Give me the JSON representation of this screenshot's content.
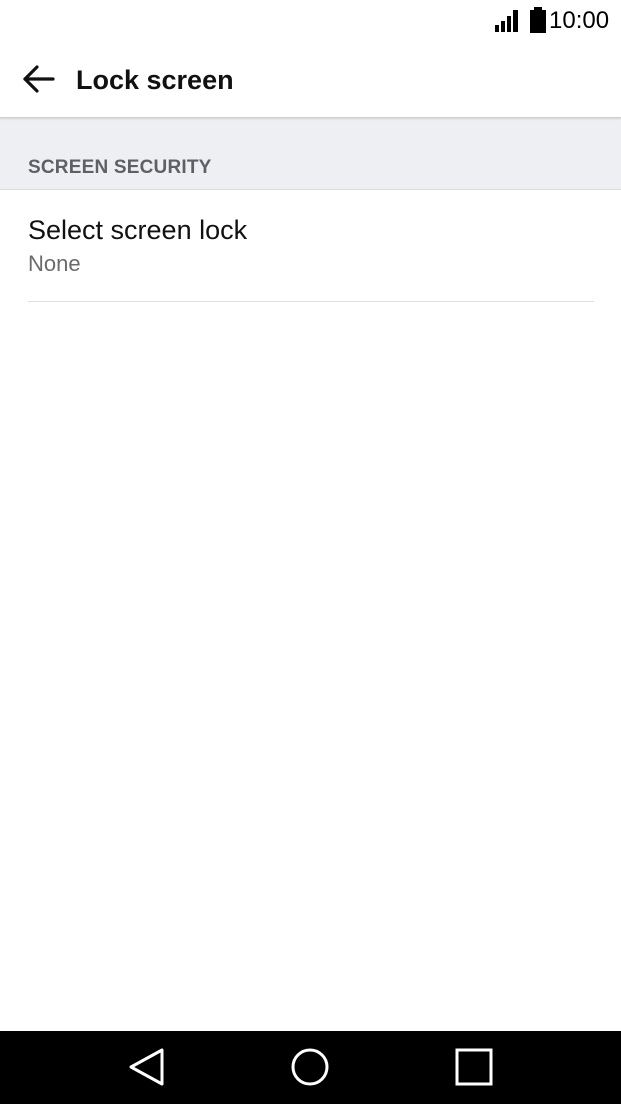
{
  "status_bar": {
    "time": "10:00",
    "signal_icon": "signal-icon",
    "battery_icon": "battery-icon"
  },
  "app_bar": {
    "back_icon": "arrow-back-icon",
    "title": "Lock screen"
  },
  "section": {
    "header": "SCREEN SECURITY"
  },
  "items": [
    {
      "title": "Select screen lock",
      "subtitle": "None"
    }
  ],
  "nav_bar": {
    "back_icon": "triangle-back-icon",
    "home_icon": "circle-home-icon",
    "recent_icon": "square-recents-icon"
  },
  "colors": {
    "section_bg": "#eeeff3",
    "section_text": "#5f6065",
    "nav_bg": "#000000"
  }
}
